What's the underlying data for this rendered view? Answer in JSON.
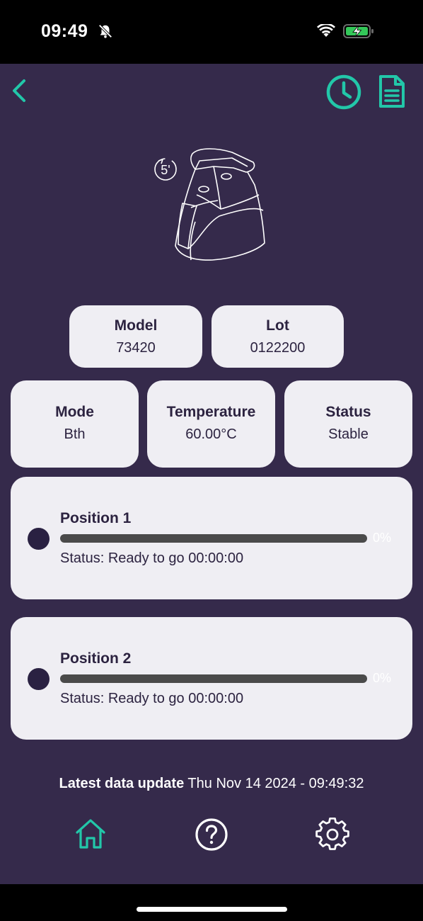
{
  "status_bar": {
    "time": "09:49"
  },
  "header": {},
  "info": {
    "model": {
      "label": "Model",
      "value": "73420"
    },
    "lot": {
      "label": "Lot",
      "value": "0122200"
    },
    "mode": {
      "label": "Mode",
      "value": "Bth"
    },
    "temperature": {
      "label": "Temperature",
      "value": "60.00°C"
    },
    "status": {
      "label": "Status",
      "value": "Stable"
    }
  },
  "device_timer_label": "5'",
  "positions": [
    {
      "title": "Position 1",
      "progress": 0,
      "percent_text": "0%",
      "status": "Status: Ready to go 00:00:00"
    },
    {
      "title": "Position 2",
      "progress": 0,
      "percent_text": "0%",
      "status": "Status: Ready to go 00:00:00"
    }
  ],
  "footer": {
    "latest_label": "Latest data update",
    "latest_value": "Thu Nov 14 2024 - 09:49:32"
  },
  "nav": [
    "home-icon",
    "help-icon",
    "settings-icon"
  ],
  "colors": {
    "background": "#352A4B",
    "accent": "#22C7A9",
    "card": "#EFEEF3",
    "text": "#2c2340"
  }
}
